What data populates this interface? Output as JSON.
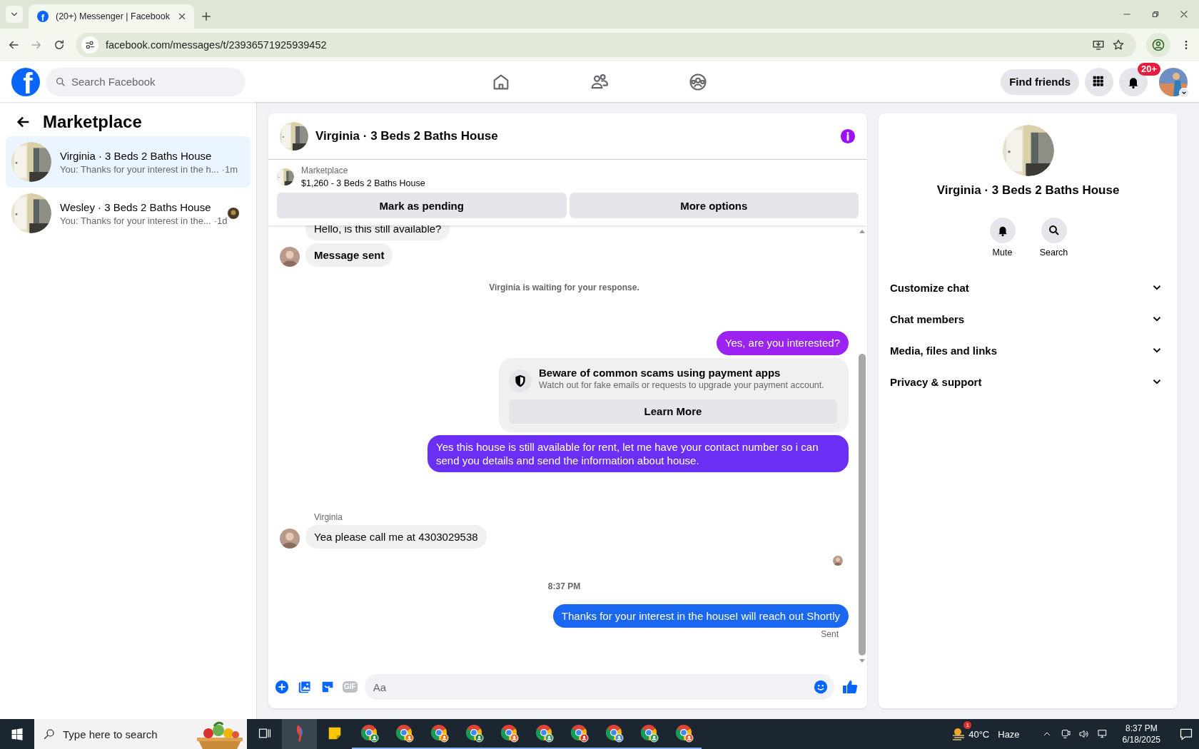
{
  "browser": {
    "tab_icon": "f",
    "tab_title": "(20+) Messenger | Facebook",
    "url": "facebook.com/messages/t/23936571925939452"
  },
  "header": {
    "logo": "f",
    "search_placeholder": "Search Facebook",
    "nav": [
      {
        "kind": "home"
      },
      {
        "kind": "friends"
      },
      {
        "kind": "groups"
      }
    ],
    "find_friends": "Find friends",
    "notification_badge": "20+"
  },
  "sidebar": {
    "title": "Marketplace",
    "threads": [
      {
        "name": "Virginia · 3 Beds 2 Baths House",
        "preview": "You: Thanks for your interest in the h...",
        "time": "·1m",
        "selected": true,
        "seen": false
      },
      {
        "name": "Wesley · 3 Beds 2 Baths House",
        "preview": "You: Thanks for your interest in the...",
        "time": "·1d",
        "selected": false,
        "seen": true
      }
    ]
  },
  "chat": {
    "title": "Virginia · 3 Beds 2 Baths House",
    "listing": {
      "label": "Marketplace",
      "item": "$1,260 - 3 Beds 2 Baths House"
    },
    "actions": [
      "Mark as pending",
      "More options"
    ],
    "messages": [
      {
        "kind": "incoming",
        "text": "Hello, is this still available?",
        "emphasis": false
      },
      {
        "kind": "incoming",
        "text": "Message sent",
        "emphasis": true
      },
      {
        "kind": "system",
        "text": "Virginia is waiting for your response."
      },
      {
        "kind": "outgoing",
        "text": "Yes, are you interested?",
        "color": "#9b22f0"
      },
      {
        "kind": "notice",
        "title": "Beware of common scams using payment apps",
        "text": "Watch out for fake emails or requests to upgrade your payment account.",
        "button": "Learn More"
      },
      {
        "kind": "outgoing",
        "text": "Yes this house is still available for rent, let me have your contact number so i can send you details and send the information about house.",
        "color": "#6a2ef4"
      },
      {
        "kind": "sender",
        "text": "Virginia"
      },
      {
        "kind": "incoming",
        "text": "Yea please call me at 4303029538",
        "emphasis": false
      },
      {
        "kind": "seen"
      },
      {
        "kind": "time",
        "text": "8:37 PM"
      },
      {
        "kind": "outgoing",
        "text": "Thanks for your interest in the houseI will reach out Shortly",
        "color": "#1a68f2"
      },
      {
        "kind": "status",
        "text": "Sent"
      }
    ],
    "composer": {
      "gif": "GIF",
      "placeholder": "Aa"
    }
  },
  "info": {
    "title": "Virginia · 3 Beds 2 Baths House",
    "actions": [
      {
        "kind": "mute",
        "label": "Mute"
      },
      {
        "kind": "search",
        "label": "Search"
      }
    ],
    "sections": [
      {
        "label": "Customize chat",
        "expanded": false
      },
      {
        "label": "Chat members",
        "expanded": false
      },
      {
        "label": "Media, files and links",
        "expanded": false
      },
      {
        "label": "Privacy & support",
        "expanded": false
      }
    ]
  },
  "taskbar": {
    "search_placeholder": "Type here to search",
    "apps": [
      {
        "kind": "task-view",
        "selected": false
      },
      {
        "kind": "pen",
        "selected": true
      },
      {
        "kind": "notes",
        "selected": false
      },
      {
        "kind": "chrome",
        "selected": false,
        "color": "#1e8e3e"
      },
      {
        "kind": "chrome",
        "selected": false,
        "color": "#e8710a"
      },
      {
        "kind": "chrome",
        "selected": false,
        "color": "#e37400"
      },
      {
        "kind": "chrome",
        "selected": false,
        "color": "#188038"
      },
      {
        "kind": "chrome",
        "selected": false,
        "color": "#f06a2a"
      },
      {
        "kind": "chrome",
        "selected": false,
        "color": "#3c9a6a"
      },
      {
        "kind": "chrome",
        "selected": false,
        "color": "#d93025"
      },
      {
        "kind": "chrome",
        "selected": false,
        "color": "#4a90c0"
      },
      {
        "kind": "chrome",
        "selected": false,
        "color": "#2e9e58"
      },
      {
        "kind": "chrome",
        "selected": false,
        "color": "#e65c2b"
      }
    ],
    "weather": {
      "badge": "1",
      "temp": "40°C",
      "condition": "Haze"
    },
    "time": "8:37 PM",
    "date": "6/18/2025"
  }
}
